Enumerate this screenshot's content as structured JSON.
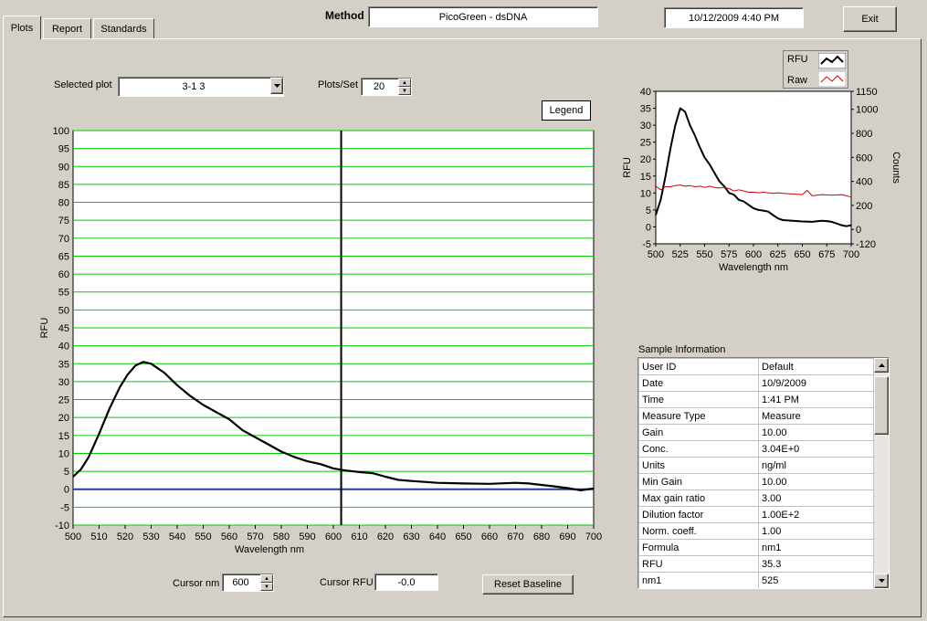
{
  "tabs": [
    {
      "label": "Plots",
      "active": true
    },
    {
      "label": "Report",
      "active": false
    },
    {
      "label": "Standards",
      "active": false
    }
  ],
  "header": {
    "method_label": "Method",
    "method_value": "PicoGreen - dsDNA",
    "datetime": "10/12/2009  4:40 PM",
    "exit_label": "Exit"
  },
  "controls": {
    "selected_plot_label": "Selected plot",
    "selected_plot_value": "3-1 3",
    "plots_per_set_label": "Plots/Set",
    "plots_per_set_value": "20",
    "legend_label": "Legend",
    "cursor_nm_label": "Cursor nm",
    "cursor_nm_value": "600",
    "cursor_rfu_label": "Cursor RFU",
    "cursor_rfu_value": "-0.0",
    "reset_baseline_label": "Reset Baseline"
  },
  "legend": {
    "items": [
      {
        "name": "RFU",
        "color": "#000000"
      },
      {
        "name": "Raw",
        "color": "#cc0000"
      }
    ]
  },
  "sample_info": {
    "title": "Sample Information",
    "rows": [
      {
        "key": "User ID",
        "value": "Default"
      },
      {
        "key": "Date",
        "value": "10/9/2009"
      },
      {
        "key": "Time",
        "value": "1:41 PM"
      },
      {
        "key": "Measure Type",
        "value": "Measure"
      },
      {
        "key": "Gain",
        "value": "10.00"
      },
      {
        "key": "Conc.",
        "value": "3.04E+0"
      },
      {
        "key": "Units",
        "value": "ng/ml"
      },
      {
        "key": "Min Gain",
        "value": "10.00"
      },
      {
        "key": "Max gain ratio",
        "value": "3.00"
      },
      {
        "key": "Dilution factor",
        "value": "1.00E+2"
      },
      {
        "key": "Norm. coeff.",
        "value": "1.00"
      },
      {
        "key": "Formula",
        "value": "nm1"
      },
      {
        "key": "RFU",
        "value": "35.3"
      },
      {
        "key": "nm1",
        "value": "525"
      }
    ]
  },
  "chart_data": [
    {
      "type": "line",
      "xlabel": "Wavelength nm",
      "ylabel": "RFU",
      "xlim": [
        500,
        700
      ],
      "ylim": [
        -10,
        100
      ],
      "xticks": [
        "500",
        "510",
        "520",
        "530",
        "540",
        "550",
        "560",
        "570",
        "580",
        "590",
        "600",
        "610",
        "620",
        "630",
        "640",
        "650",
        "660",
        "670",
        "680",
        "690",
        "700"
      ],
      "yticks": [
        "-10",
        "-5",
        "0",
        "5",
        "10",
        "15",
        "20",
        "25",
        "30",
        "35",
        "40",
        "45",
        "50",
        "55",
        "60",
        "65",
        "70",
        "75",
        "80",
        "85",
        "90",
        "95",
        "100"
      ],
      "grid": true,
      "grid_color": "#00cc00",
      "baseline": {
        "y": 0,
        "color": "#1f3fa0"
      },
      "cursor_x": 603,
      "series": [
        {
          "color": "#000000",
          "x": [
            500,
            503,
            506,
            510,
            514,
            518,
            521,
            524,
            527,
            530,
            535,
            540,
            545,
            550,
            555,
            560,
            565,
            570,
            575,
            580,
            585,
            590,
            595,
            600,
            605,
            610,
            615,
            620,
            625,
            630,
            640,
            650,
            660,
            670,
            675,
            680,
            685,
            690,
            695,
            700
          ],
          "y": [
            3.5,
            5.5,
            9,
            15.5,
            22.5,
            28.5,
            32,
            34.5,
            35.5,
            35,
            32.5,
            29,
            26,
            23.5,
            21.5,
            19.5,
            16.5,
            14.5,
            12.5,
            10.5,
            9,
            7.8,
            7,
            5.8,
            5.2,
            4.8,
            4.5,
            3.5,
            2.6,
            2.3,
            1.8,
            1.6,
            1.5,
            1.8,
            1.6,
            1.2,
            0.8,
            0.3,
            -0.3,
            0.2
          ]
        }
      ]
    },
    {
      "type": "line",
      "xlabel": "Wavelength  nm",
      "ylabel": "RFU",
      "y2label": "Counts",
      "xlim": [
        500,
        700
      ],
      "ylim": [
        -5,
        40
      ],
      "y2lim": [
        -120,
        1150
      ],
      "xticks": [
        "500",
        "525",
        "550",
        "575",
        "600",
        "625",
        "650",
        "675",
        "700"
      ],
      "yticks": [
        "-5",
        "0",
        "5",
        "10",
        "15",
        "20",
        "25",
        "30",
        "35",
        "40"
      ],
      "y2ticks": [
        "-120",
        "0",
        "200",
        "400",
        "600",
        "800",
        "1000",
        "1150"
      ],
      "series": [
        {
          "name": "RFU",
          "color": "#000000",
          "x": [
            500,
            505,
            510,
            515,
            520,
            525,
            530,
            535,
            540,
            545,
            550,
            555,
            560,
            565,
            570,
            575,
            580,
            585,
            590,
            595,
            600,
            605,
            610,
            615,
            620,
            625,
            630,
            640,
            650,
            660,
            670,
            675,
            680,
            685,
            690,
            695,
            700
          ],
          "y": [
            3.5,
            8,
            15,
            23,
            30,
            35,
            34,
            30,
            27,
            23.5,
            20.5,
            18.5,
            16,
            13.5,
            12,
            10,
            9.5,
            8,
            7.5,
            6.5,
            5.5,
            5,
            4.8,
            4.5,
            3.5,
            2.5,
            2,
            1.8,
            1.6,
            1.5,
            1.8,
            1.7,
            1.5,
            1,
            0.5,
            0.2,
            0.5
          ]
        },
        {
          "name": "Raw",
          "axis": "y2",
          "color": "#cc0000",
          "x": [
            500,
            505,
            510,
            515,
            520,
            525,
            530,
            535,
            540,
            545,
            550,
            555,
            560,
            565,
            570,
            575,
            580,
            585,
            590,
            595,
            600,
            605,
            610,
            615,
            620,
            625,
            630,
            640,
            650,
            655,
            660,
            670,
            680,
            690,
            700
          ],
          "y": [
            360,
            330,
            355,
            355,
            365,
            370,
            360,
            365,
            355,
            360,
            350,
            360,
            350,
            345,
            350,
            340,
            320,
            330,
            320,
            310,
            310,
            305,
            310,
            305,
            300,
            305,
            300,
            295,
            290,
            325,
            280,
            290,
            285,
            290,
            270
          ]
        }
      ]
    }
  ]
}
